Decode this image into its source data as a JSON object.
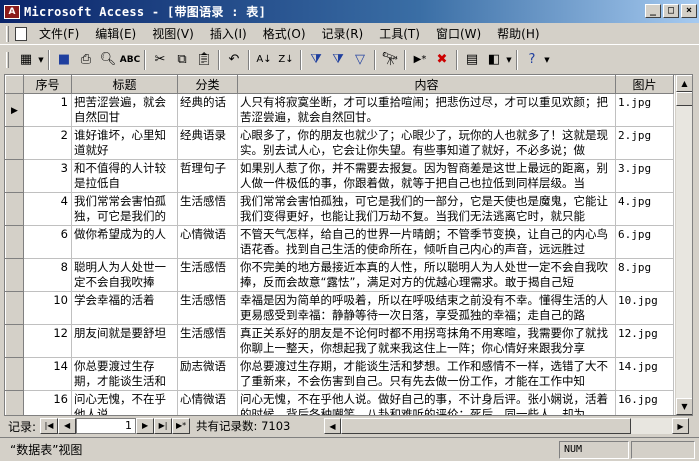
{
  "window": {
    "title": "Microsoft Access - [带图语录 : 表]",
    "icon_label": "A"
  },
  "menu": [
    "文件(F)",
    "编辑(E)",
    "视图(V)",
    "插入(I)",
    "格式(O)",
    "记录(R)",
    "工具(T)",
    "窗口(W)",
    "帮助(H)"
  ],
  "toolbar_icons": [
    "view-icon",
    "save-icon",
    "print-icon",
    "print-preview-icon",
    "spelling-icon",
    "cut-icon",
    "copy-icon",
    "paste-icon",
    "undo-icon",
    "sort-ascending-icon",
    "sort-descending-icon",
    "filter-by-selection-icon",
    "filter-by-form-icon",
    "apply-filter-icon",
    "find-icon",
    "new-record-icon",
    "delete-record-icon",
    "database-window-icon",
    "new-object-icon",
    "help-icon"
  ],
  "table": {
    "columns": [
      "序号",
      "标题",
      "分类",
      "内容",
      "图片"
    ],
    "rows": [
      {
        "id": "1",
        "title": "把苦涩尝遍，就会自然回甘",
        "category": "经典的话",
        "content": "人只有将寂寞坐断，才可以重拾喧闹；把悲伤过尽，才可以重见欢颜；把苦涩尝遍，就会自然回甘。",
        "image": "1.jpg"
      },
      {
        "id": "2",
        "title": "谁好谁坏，心里知道就好",
        "category": "经典语录",
        "content": "心眼多了，你的朋友也就少了；心眼少了，玩你的人也就多了！这就是现实。别去试人心，它会让你失望。有些事知道了就好，不必多说；做",
        "image": "2.jpg"
      },
      {
        "id": "3",
        "title": "和不值得的人计较是拉低自",
        "category": "哲理句子",
        "content": "如果别人惹了你，并不需要去报复。因为智商差是这世上最远的距离，别人做一件极低的事，你跟着做，就等于把自己也拉低到同样层级。当",
        "image": "3.jpg"
      },
      {
        "id": "4",
        "title": "我们常常会害怕孤独，可它是我们的",
        "category": "生活感悟",
        "content": "我们常常会害怕孤独，可它是我们的一部分，它是天使也是魔鬼，它能让我们变得更好，也能让我们万劫不复。当我们无法逃离它时，就只能",
        "image": "4.jpg"
      },
      {
        "id": "6",
        "title": "做你希望成为的人",
        "category": "心情微语",
        "content": "不管天气怎样，给自己的世界一片晴朗；不管季节变换，让自己的内心鸟语花香。找到自己生活的使命所在，倾听自己内心的声音，远远胜过",
        "image": "6.jpg"
      },
      {
        "id": "8",
        "title": "聪明人为人处世一定不会自我吹捧",
        "category": "生活感悟",
        "content": "你不完美的地方最接近本真的人性，所以聪明人为人处世一定不会自我吹捧，反而会故意“露怯”，满足对方的优越心理需求。敢于揭自己短",
        "image": "8.jpg"
      },
      {
        "id": "10",
        "title": "学会幸福的活着",
        "category": "生活感悟",
        "content": "幸福是因为简单的呼吸着，所以在呼吸结束之前没有不幸。懂得生活的人更易感受到幸福：静静等待一次日落，享受孤独的幸福；走自己的路",
        "image": "10.jpg"
      },
      {
        "id": "12",
        "title": "朋友间就是要舒坦",
        "category": "生活感悟",
        "content": "真正关系好的朋友是不论何时都不用拐弯抹角不用寒暄，我需要你了就找你聊上一整天，你想起我了就来我这住上一阵；你心情好来跟我分享",
        "image": "12.jpg"
      },
      {
        "id": "14",
        "title": "你总要渡过生存期，才能谈生活和",
        "category": "励志微语",
        "content": "你总要渡过生存期，才能谈生活和梦想。工作和感情不一样，选错了大不了重新来，不会伤害到自己。只有先去做一份工作，才能在工作中知",
        "image": "14.jpg"
      },
      {
        "id": "16",
        "title": "问心无愧，不在乎他人说",
        "category": "心情微语",
        "content": "问心无愧，不在乎他人说。做好自己的事，不计身后评。张小娴说，活着的时候，背后各种嘲笑、八卦和难听的评价；死后，同一些人，却为",
        "image": "16.jpg"
      }
    ]
  },
  "navigation": {
    "label": "记录:",
    "current": "1",
    "total_text": "共有记录数: 7103"
  },
  "status": {
    "view_text": "“数据表”视图",
    "num_indicator": "NUM"
  }
}
